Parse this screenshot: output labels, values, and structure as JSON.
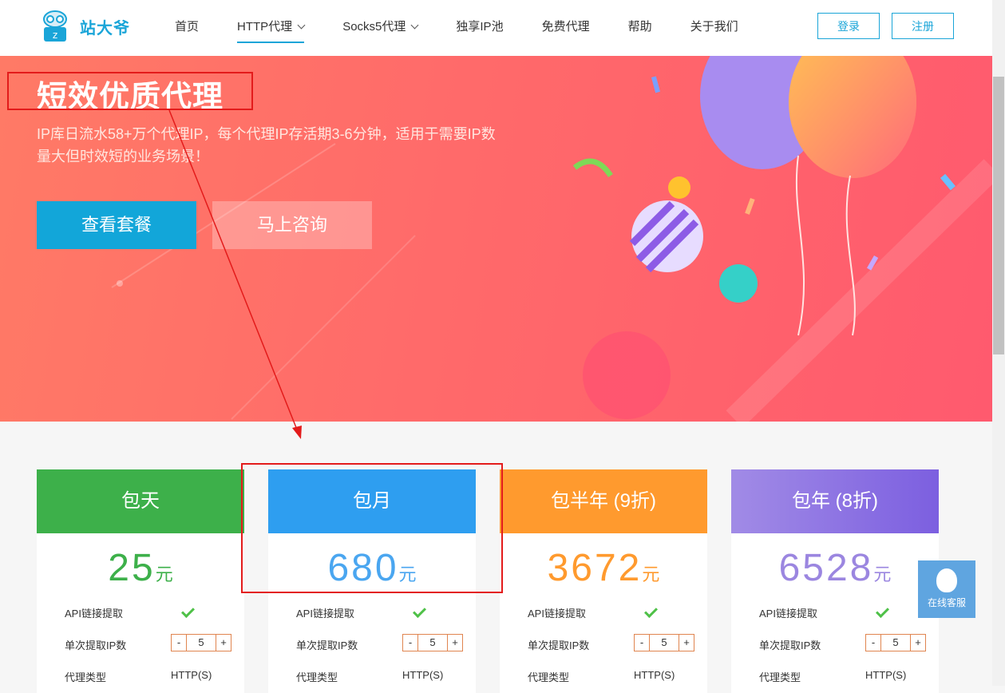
{
  "brand": {
    "name": "站大爷"
  },
  "nav": {
    "items": [
      {
        "label": "首页",
        "dropdown": false,
        "active": false
      },
      {
        "label": "HTTP代理",
        "dropdown": true,
        "active": true
      },
      {
        "label": "Socks5代理",
        "dropdown": true,
        "active": false
      },
      {
        "label": "独享IP池",
        "dropdown": false,
        "active": false
      },
      {
        "label": "免费代理",
        "dropdown": false,
        "active": false
      },
      {
        "label": "帮助",
        "dropdown": false,
        "active": false
      },
      {
        "label": "关于我们",
        "dropdown": false,
        "active": false
      }
    ],
    "login": "登录",
    "register": "注册"
  },
  "hero": {
    "title": "短效优质代理",
    "desc": "IP库日流水58+万个代理IP，每个代理IP存活期3-6分钟，适用于需要IP数量大但时效短的业务场景！",
    "btn_plans": "查看套餐",
    "btn_consult": "马上咨询"
  },
  "plans": [
    {
      "name": "包天",
      "price": "25",
      "unit": "元",
      "color": "#3db04a",
      "api_label": "API链接提取",
      "count_label": "单次提取IP数",
      "count": "5",
      "type_label": "代理类型",
      "type_value": "HTTP(S)"
    },
    {
      "name": "包月",
      "price": "680",
      "unit": "元",
      "color": "#2e9ef0",
      "api_label": "API链接提取",
      "count_label": "单次提取IP数",
      "count": "5",
      "type_label": "代理类型",
      "type_value": "HTTP(S)"
    },
    {
      "name": "包半年 (9折)",
      "price": "3672",
      "unit": "元",
      "color": "#ff9a2e",
      "api_label": "API链接提取",
      "count_label": "单次提取IP数",
      "count": "5",
      "type_label": "代理类型",
      "type_value": "HTTP(S)"
    },
    {
      "name": "包年 (8折)",
      "price": "6528",
      "unit": "元",
      "color": "#9b7ee0",
      "api_label": "API链接提取",
      "count_label": "单次提取IP数",
      "count": "5",
      "type_label": "代理类型",
      "type_value": "HTTP(S)"
    }
  ],
  "stepper": {
    "minus": "-",
    "plus": "+"
  },
  "service": {
    "label": "在线客服"
  }
}
